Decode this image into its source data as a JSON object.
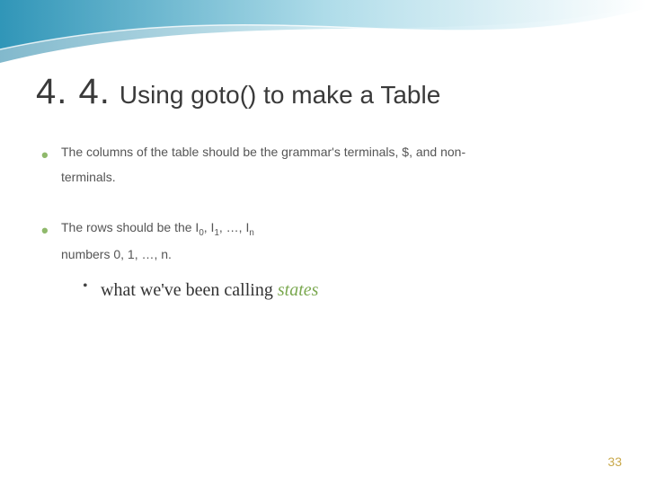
{
  "title": {
    "number": "4. 4.",
    "text": "Using goto() to make a Table"
  },
  "bullets": {
    "b1_line1": "The columns of the table should be the grammar's terminals, $, and non-",
    "b1_line2": "terminals.",
    "b2_line1_pre": "The rows should be the I",
    "b2_line1_mid1": ", I",
    "b2_line1_mid2": ", …, I",
    "b2_line2": "numbers 0, 1, …, n.",
    "b2_sub_pre": "what we've been calling ",
    "b2_sub_em": "states",
    "sub0": "0",
    "sub1": "1",
    "subn": "n"
  },
  "page_number": "33"
}
